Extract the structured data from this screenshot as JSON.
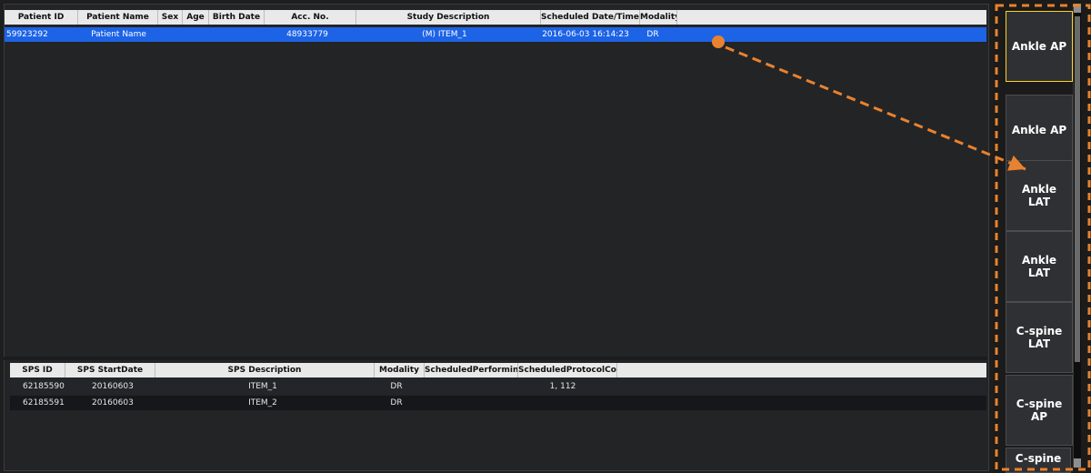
{
  "worklist": {
    "columns": [
      "Patient ID",
      "Patient Name",
      "Sex",
      "Age",
      "Birth Date",
      "Acc. No.",
      "Study Description",
      "Scheduled Date/Time",
      "Modality"
    ],
    "rows": [
      [
        "59923292",
        "Patient Name",
        "",
        "",
        "",
        "48933779",
        "(M) ITEM_1",
        "2016-06-03 16:14:23",
        "DR"
      ]
    ]
  },
  "sps": {
    "columns": [
      "SPS ID",
      "SPS StartDate",
      "SPS Description",
      "Modality",
      "ScheduledPerformingPh...",
      "ScheduledProtocolCode..."
    ],
    "rows": [
      [
        "62185590",
        "20160603",
        "ITEM_1",
        "DR",
        "",
        "1, 112"
      ],
      [
        "62185591",
        "20160603",
        "ITEM_2",
        "DR",
        "",
        ""
      ]
    ]
  },
  "protocol_list": {
    "items": [
      "Ankle AP",
      "Ankle AP",
      "Ankle\nLAT",
      "Ankle\nLAT",
      "C-spine\nLAT",
      "C-spine\nAP",
      "C-spine"
    ],
    "active_index": 0
  },
  "colors": {
    "selected_row": "#1d63e6",
    "annotation_orange": "#e9822e",
    "active_tile_border": "#ffd21f"
  }
}
